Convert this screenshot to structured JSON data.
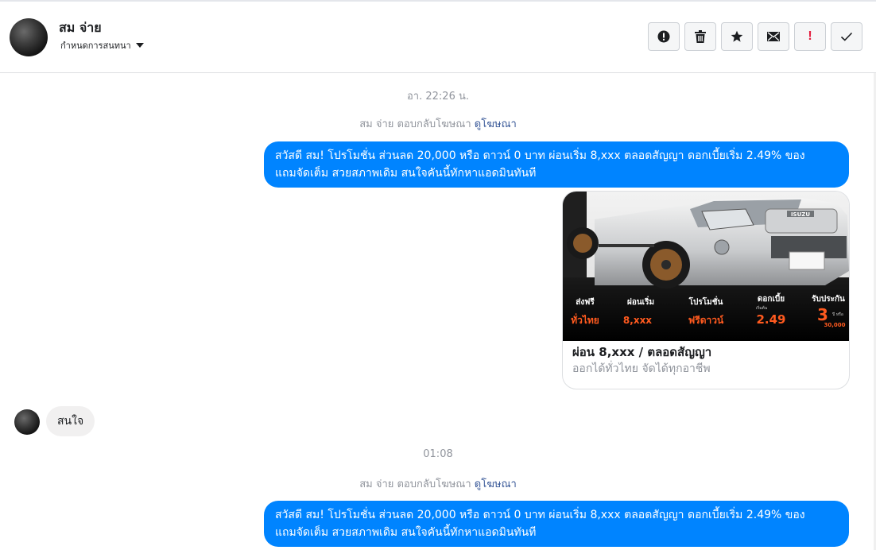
{
  "header": {
    "name": "สม จ่าย",
    "subtitle": "กำหนดการสนทนา",
    "actions": [
      {
        "id": "report",
        "icon": "alert-circle-icon"
      },
      {
        "id": "delete",
        "icon": "trash-icon"
      },
      {
        "id": "star",
        "icon": "star-icon"
      },
      {
        "id": "mark-unread",
        "icon": "envelope-icon"
      },
      {
        "id": "spam",
        "icon": "exclamation-icon",
        "label": "!"
      },
      {
        "id": "done",
        "icon": "checkmark-icon"
      }
    ]
  },
  "conversation": {
    "timestamp_1": "อา. 22:26 น.",
    "ad_reply_1": {
      "text": "สม จ่าย ตอบกลับโฆษณา",
      "link": "ดูโฆษณา"
    },
    "message_1": {
      "line1": "สวัสดี สม! โปรโมชั่น ส่วนลด 20,000 หรือ ดาวน์ 0 บาท ผ่อนเริ่ม 8,xxx ตลอดสัญญา ดอกเบี้ยเริ่ม 2.49% ของ",
      "line2": "แถมจัดเต็ม สวยสภาพเดิม สนใจคันนี้ทักหาแอดมินทันที"
    },
    "ad_card": {
      "title": "ผ่อน 8,xxx / ตลอดสัญญา",
      "subtitle": "ออกได้ทั่วไทย จัดได้ทุกอาชีพ",
      "image_texts": {
        "plate": "ISUZU",
        "f1_top": "ส่งฟรี",
        "f1_bottom": "ทั่วไทย",
        "f2_top": "ผ่อนเริ่ม",
        "f2_bottom": "8,xxx",
        "f3_top": "โปรโมชั่น",
        "f3_bottom": "ฟรีดาวน์",
        "f4_top": "ดอกเบี้ย",
        "f4_small": "เริ่มต้น",
        "f4_bottom": "2.49",
        "f5_top": "รับประกัน",
        "f5_bottom": "3",
        "f5_small": "ปี หรือ",
        "f5_km": "30,000"
      }
    },
    "incoming_message": "สนใจ",
    "timestamp_2": "01:08",
    "ad_reply_2": {
      "text": "สม จ่าย ตอบกลับโฆษณา",
      "link": "ดูโฆษณา"
    },
    "message_2": {
      "line1": "สวัสดี สม! โปรโมชั่น ส่วนลด 20,000 หรือ ดาวน์ 0 บาท ผ่อนเริ่ม 8,xxx ตลอดสัญญา ดอกเบี้ยเริ่ม 2.49% ของ",
      "line2": "แถมจัดเต็ม สวยสภาพเดิม สนใจคันนี้ทักหาแอดมินทันที"
    }
  },
  "colors": {
    "outgoing_bubble": "#0084ff",
    "incoming_bubble": "#f1f0f0",
    "link": "#385898",
    "meta_text": "#90949c",
    "spam_red": "#e41e3f",
    "promo_orange": "#ff5a1f"
  }
}
